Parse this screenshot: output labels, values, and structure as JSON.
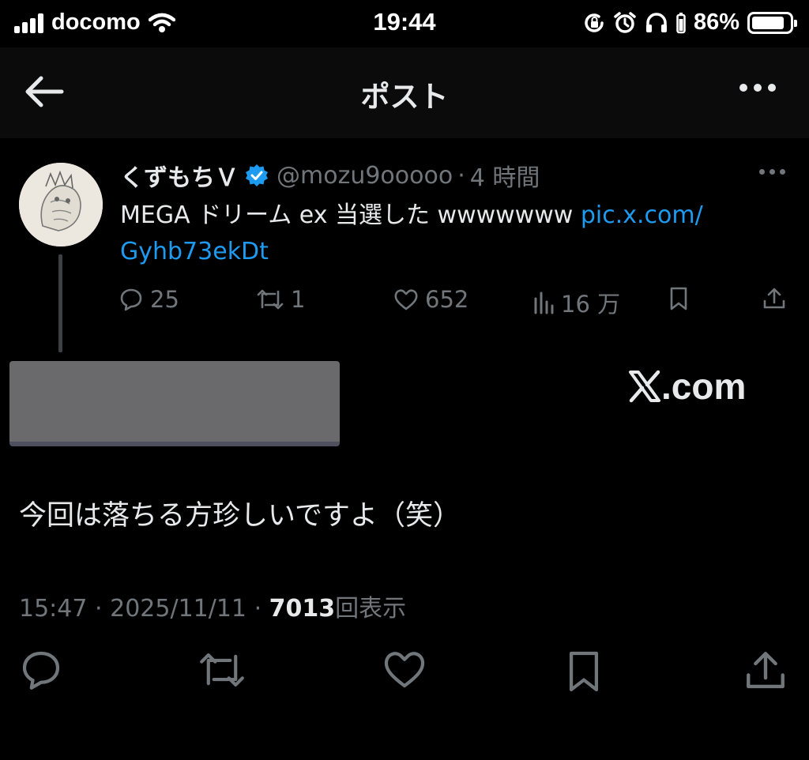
{
  "status_bar": {
    "carrier": "docomo",
    "time": "19:44",
    "battery_percent": "86%",
    "battery_level": 0.86,
    "icons": [
      "signal-icon",
      "wifi-icon",
      "screen-lock-icon",
      "alarm-icon",
      "headphones-icon",
      "battery-icon"
    ]
  },
  "header": {
    "title": "ポスト",
    "back_icon": "arrow-left-icon",
    "more_icon": "more-horizontal-icon"
  },
  "quoted_post": {
    "display_name": "くずもちＶ",
    "verified": true,
    "handle": "@mozu9ooooo",
    "separator": "·",
    "age": "4 時間",
    "text": "MEGA ドリーム ex 当選した wwwwwww ",
    "link_line1": "pic.x.com/",
    "link_line2": "Gyhb73ekDt",
    "metrics": {
      "replies": "25",
      "reposts": "1",
      "likes": "652",
      "views": "16 万"
    }
  },
  "embed": {
    "brand": ".com",
    "brand_icon": "x-logo-icon"
  },
  "main_post": {
    "text": "今回は落ちる方珍しいですよ（笑）",
    "time": "15:47",
    "separator": "·",
    "date": "2025/11/11",
    "views_count": "7013",
    "views_label": "回表示"
  },
  "colors": {
    "background": "#000000",
    "text": "#e7e9ea",
    "secondary": "#71767b",
    "link": "#1d9bf0",
    "verified": "#1d9bf0"
  }
}
